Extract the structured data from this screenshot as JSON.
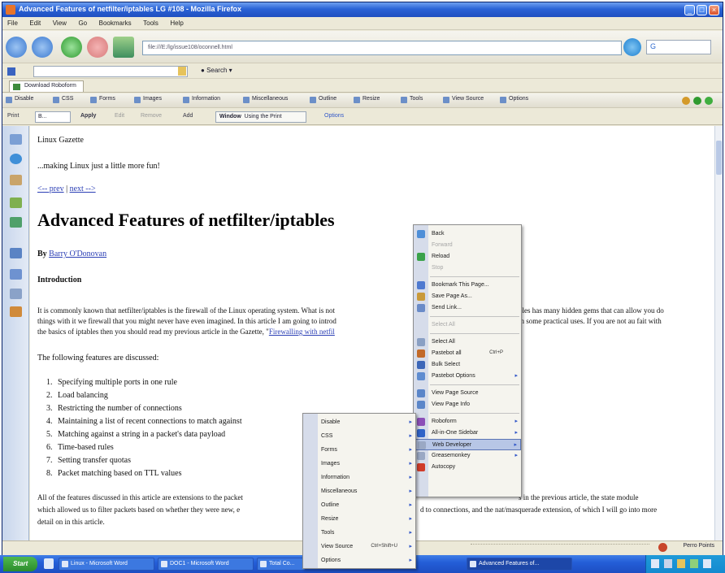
{
  "window": {
    "title": "Advanced Features of netfilter/iptables LG #108 - Mozilla Firefox",
    "min": "_",
    "max": "□",
    "close": "×"
  },
  "menubar": [
    "File",
    "Edit",
    "View",
    "Go",
    "Bookmarks",
    "Tools",
    "Help"
  ],
  "navbar": {
    "url": "file:///E:/lg/issue108/oconnell.html",
    "go_label": "G"
  },
  "searchbar": {
    "search_label": "Search"
  },
  "tabs": [
    "Download Roboform"
  ],
  "devbar": {
    "items": [
      "Disable",
      "CSS",
      "Forms",
      "Images",
      "Information",
      "Miscellaneous",
      "Outline",
      "Resize",
      "Tools",
      "View Source",
      "Options"
    ]
  },
  "editbar": {
    "prefix": "Print",
    "zoom": "B...",
    "apply": "Apply",
    "edit": "Edit",
    "remove": "Remove",
    "add": "Add",
    "window_label": "Window",
    "window_value": "Using the Print",
    "options": "Options"
  },
  "content": {
    "site": "Linux Gazette",
    "tagline": "...making Linux just a little more fun!",
    "prev": "<-- prev",
    "sep": " | ",
    "next": "next -->",
    "heading": "Advanced Features of netfilter/iptables",
    "by": "By ",
    "author": "Barry O'Donovan",
    "introduction": "Introduction",
    "para1_a": "It is commonly known that netfilter/iptables is the firewall of the Linux operating system. What is not",
    "para1_b": "bles has many hidden gems that can allow you do",
    "para2_a": "things with it we firewall that you might never have even imagined. In this article I am going to introd",
    "para2_b": "th some practical uses. If you are not au fait with",
    "para3_a": "the basics of iptables then you should read my previous article in the Gazette, \"",
    "para3_link": "Firewalling with netfil",
    "following": "The following features are discussed:",
    "features": [
      "Specifying multiple ports in one rule",
      "Load balancing",
      "Restricting the number of connections",
      "Maintaining a list of recent connections to match against",
      "Matching against a string in a packet's data payload",
      "Time-based rules",
      "Setting transfer quotas",
      "Packet matching based on TTL values"
    ],
    "para4_a": "All of the features discussed in this article are extensions to the packet",
    "para4_b": "s in the previous article, the state module",
    "para5_a": "which allowed us to filter packets based on whether they were new, e",
    "para5_b": "d to connections, and the nat/masquerade extension, of which I will go into more",
    "para6": "detail on in this article."
  },
  "context_menu": [
    {
      "label": "Back",
      "enabled": true,
      "submenu": false,
      "color": "#4f8fd8"
    },
    {
      "label": "Forward",
      "enabled": false,
      "submenu": false
    },
    {
      "label": "Reload",
      "enabled": true,
      "submenu": false,
      "color": "#3aa24a"
    },
    {
      "label": "Stop",
      "enabled": false,
      "submenu": false
    },
    {
      "sep": true
    },
    {
      "label": "Bookmark This Page...",
      "enabled": true,
      "submenu": false,
      "color": "#4f7ad0"
    },
    {
      "label": "Save Page As...",
      "enabled": true,
      "submenu": false,
      "color": "#c99a3a"
    },
    {
      "label": "Send Link...",
      "enabled": true,
      "submenu": false,
      "color": "#6a8bc8"
    },
    {
      "sep": true
    },
    {
      "label": "Select All",
      "enabled": false,
      "submenu": false
    },
    {
      "sep": true
    },
    {
      "label": "Select All",
      "enabled": true,
      "submenu": false,
      "color": "#8aa0c4"
    },
    {
      "label": "Pastebot all",
      "enabled": true,
      "submenu": false,
      "shortcut": "Ctrl+P",
      "color": "#c26a2a"
    },
    {
      "label": "Bulk Select",
      "enabled": true,
      "submenu": false,
      "color": "#3c66b8"
    },
    {
      "label": "Pastebot Options",
      "enabled": true,
      "submenu": true,
      "color": "#5f8cd0"
    },
    {
      "sep": true
    },
    {
      "label": "View Page Source",
      "enabled": true,
      "submenu": false,
      "color": "#5b86c9"
    },
    {
      "label": "View Page Info",
      "enabled": true,
      "submenu": false,
      "color": "#5b86c9"
    },
    {
      "sep": true
    },
    {
      "label": "Roboform",
      "enabled": true,
      "submenu": true,
      "color": "#8c4fb8"
    },
    {
      "label": "All-in-One Sidebar",
      "enabled": true,
      "submenu": true,
      "color": "#2f63c8"
    },
    {
      "label": "Web Developer",
      "enabled": true,
      "submenu": true,
      "highlight": true,
      "color": "#9aa8c4"
    },
    {
      "label": "Greasemonkey",
      "enabled": true,
      "submenu": true,
      "color": "#9aa8c4"
    },
    {
      "label": "Autocopy",
      "enabled": true,
      "submenu": false,
      "color": "#d03c2a"
    }
  ],
  "sub_menu": [
    {
      "label": "Disable"
    },
    {
      "label": "CSS"
    },
    {
      "label": "Forms"
    },
    {
      "label": "Images"
    },
    {
      "label": "Information"
    },
    {
      "label": "Miscellaneous"
    },
    {
      "label": "Outline"
    },
    {
      "label": "Resize"
    },
    {
      "label": "Tools"
    },
    {
      "label": "View Source",
      "shortcut": "Ctrl+Shift+U"
    },
    {
      "label": "Options"
    }
  ],
  "status": {
    "right": "Perro Points"
  },
  "taskbar": {
    "start": "Start",
    "tasks": [
      "Linux - Microsoft Word",
      "DOC1 - Microsoft Word",
      "Total Co...",
      "Advanced Features of..."
    ],
    "active_index": 3
  }
}
